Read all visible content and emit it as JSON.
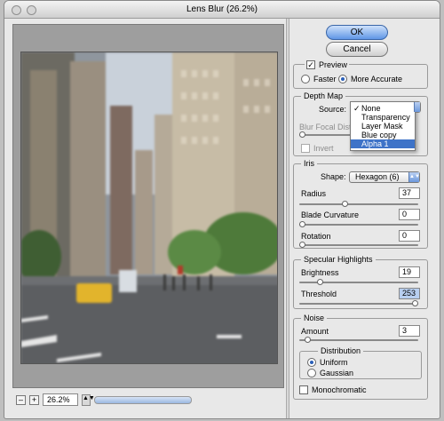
{
  "window": {
    "title": "Lens Blur (26.2%)"
  },
  "buttons": {
    "ok": "OK",
    "cancel": "Cancel"
  },
  "preview": {
    "label": "Preview",
    "checked": true,
    "faster": "Faster",
    "more_accurate": "More Accurate",
    "selected": "More Accurate"
  },
  "depth_map": {
    "group_label": "Depth Map",
    "source_label": "Source:",
    "blur_focal_label": "Blur Focal Dista",
    "invert_label": "Invert",
    "source_options": [
      "None",
      "Transparency",
      "Layer Mask",
      "Blue copy",
      "Alpha 1"
    ],
    "checked_option": "None",
    "highlighted_option": "Alpha 1"
  },
  "iris": {
    "group_label": "Iris",
    "shape_label": "Shape:",
    "shape_value": "Hexagon (6)",
    "radius_label": "Radius",
    "radius": "37",
    "blade_label": "Blade Curvature",
    "blade": "0",
    "rotation_label": "Rotation",
    "rotation": "0"
  },
  "specular": {
    "group_label": "Specular Highlights",
    "brightness_label": "Brightness",
    "brightness": "19",
    "threshold_label": "Threshold",
    "threshold": "253"
  },
  "noise": {
    "group_label": "Noise",
    "amount_label": "Amount",
    "amount": "3",
    "distribution_label": "Distribution",
    "uniform": "Uniform",
    "gaussian": "Gaussian",
    "selected": "Uniform",
    "mono_label": "Monochromatic"
  },
  "statusbar": {
    "minus": "–",
    "plus": "+",
    "zoom": "26.2%"
  }
}
